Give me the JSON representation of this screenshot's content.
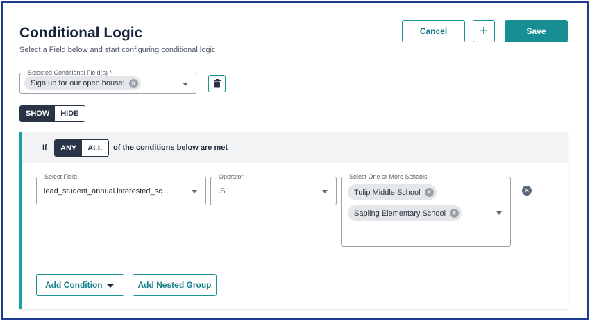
{
  "header": {
    "title": "Conditional Logic",
    "subtitle": "Select a Field below and start configuring conditional logic"
  },
  "actions": {
    "cancel_label": "Cancel",
    "add_symbol": "+",
    "save_label": "Save"
  },
  "selected_fields": {
    "label": "Selected Conditional Field(s) *",
    "chips": [
      "Sign up for our open house!"
    ]
  },
  "visibility_toggle": {
    "options": [
      "SHOW",
      "HIDE"
    ],
    "selected": "SHOW"
  },
  "condition_group": {
    "prefix": "If",
    "match_options": [
      "ANY",
      "ALL"
    ],
    "match_selected": "ANY",
    "suffix": "of the conditions below are met",
    "condition": {
      "field_label": "Select Field",
      "field_value": "lead_student_annual.interested_sc...",
      "operator_label": "Operator",
      "operator_value": "IS",
      "values_label": "Select One or More Schools",
      "values": [
        "Tulip Middle School",
        "Sapling Elementary School"
      ]
    },
    "add_condition_label": "Add Condition",
    "add_nested_group_label": "Add Nested Group"
  },
  "colors": {
    "accent": "#178f92",
    "frame_border": "#1d3a8f",
    "toggle_active": "#2b3447"
  }
}
